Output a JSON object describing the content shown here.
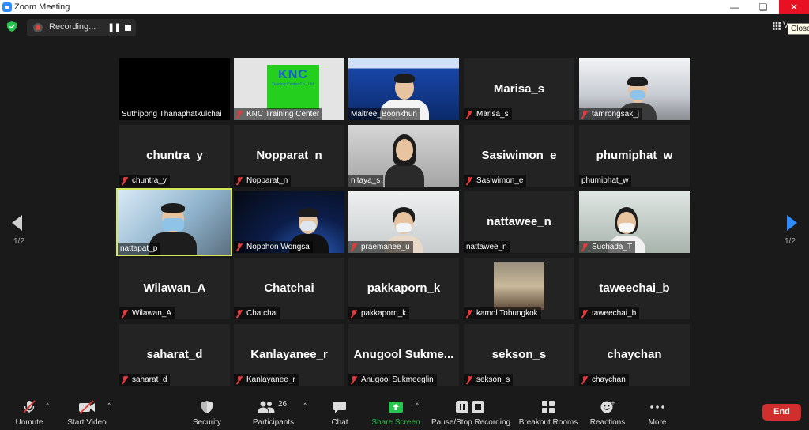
{
  "window": {
    "title": "Zoom Meeting"
  },
  "tooltip": "Close",
  "recording": {
    "label": "Recording..."
  },
  "view": {
    "label": "V"
  },
  "pages": {
    "left": "1/2",
    "right": "1/2"
  },
  "participants": [
    {
      "name": "Suthipong Thanaphatkulchai",
      "muted": false,
      "video": true
    },
    {
      "name": "KNC Training Center",
      "muted": true,
      "video": true,
      "logo_text": "KNC",
      "logo_sub": "Training Center Co., Ltd."
    },
    {
      "name": "Maitree_Boonkhun",
      "muted": false,
      "video": true
    },
    {
      "name": "Marisa_s",
      "display": "Marisa_s",
      "muted": true,
      "video": false
    },
    {
      "name": "tamrongsak_j",
      "muted": true,
      "video": true
    },
    {
      "name": "chuntra_y",
      "display": "chuntra_y",
      "muted": true,
      "video": false
    },
    {
      "name": "Nopparat_n",
      "display": "Nopparat_n",
      "muted": true,
      "video": false
    },
    {
      "name": "nitaya_s",
      "muted": false,
      "video": true
    },
    {
      "name": "Sasiwimon_e",
      "display": "Sasiwimon_e",
      "muted": true,
      "video": false
    },
    {
      "name": "phumiphat_w",
      "display": "phumiphat_w",
      "muted": false,
      "video": false
    },
    {
      "name": "nattapat_p",
      "muted": false,
      "video": true,
      "active": true
    },
    {
      "name": "Nopphon Wongsa",
      "muted": true,
      "video": true
    },
    {
      "name": "praemanee_u",
      "muted": true,
      "video": true
    },
    {
      "name": "nattawee_n",
      "display": "nattawee_n",
      "muted": false,
      "video": false
    },
    {
      "name": "Suchada_T",
      "muted": true,
      "video": true
    },
    {
      "name": "Wilawan_A",
      "display": "Wilawan_A",
      "muted": true,
      "video": false
    },
    {
      "name": "Chatchai",
      "display": "Chatchai",
      "muted": true,
      "video": false
    },
    {
      "name": "pakkaporn_k",
      "display": "pakkaporn_k",
      "muted": true,
      "video": false
    },
    {
      "name": "kamol Tobungkok",
      "muted": true,
      "video": true
    },
    {
      "name": "taweechai_b",
      "display": "taweechai_b",
      "muted": true,
      "video": false
    },
    {
      "name": "saharat_d",
      "display": "saharat_d",
      "muted": true,
      "video": false
    },
    {
      "name": "Kanlayanee_r",
      "display": "Kanlayanee_r",
      "muted": true,
      "video": false
    },
    {
      "name": "Anugool Sukmeeglin",
      "display": "Anugool  Sukme...",
      "muted": true,
      "video": false
    },
    {
      "name": "sekson_s",
      "display": "sekson_s",
      "muted": true,
      "video": false
    },
    {
      "name": "chaychan",
      "display": "chaychan",
      "muted": true,
      "video": false
    }
  ],
  "toolbar": {
    "unmute": "Unmute",
    "start_video": "Start Video",
    "security": "Security",
    "participants": "Participants",
    "participants_count": "26",
    "chat": "Chat",
    "share_screen": "Share Screen",
    "pause_stop": "Pause/Stop Recording",
    "breakout": "Breakout Rooms",
    "reactions": "Reactions",
    "more": "More",
    "end": "End"
  },
  "colors": {
    "accent": "#2d8cff",
    "share_green": "#27c54f",
    "end_red": "#d12e2e",
    "active_speaker": "#d4e85a",
    "muted_red": "#e23b3b"
  }
}
